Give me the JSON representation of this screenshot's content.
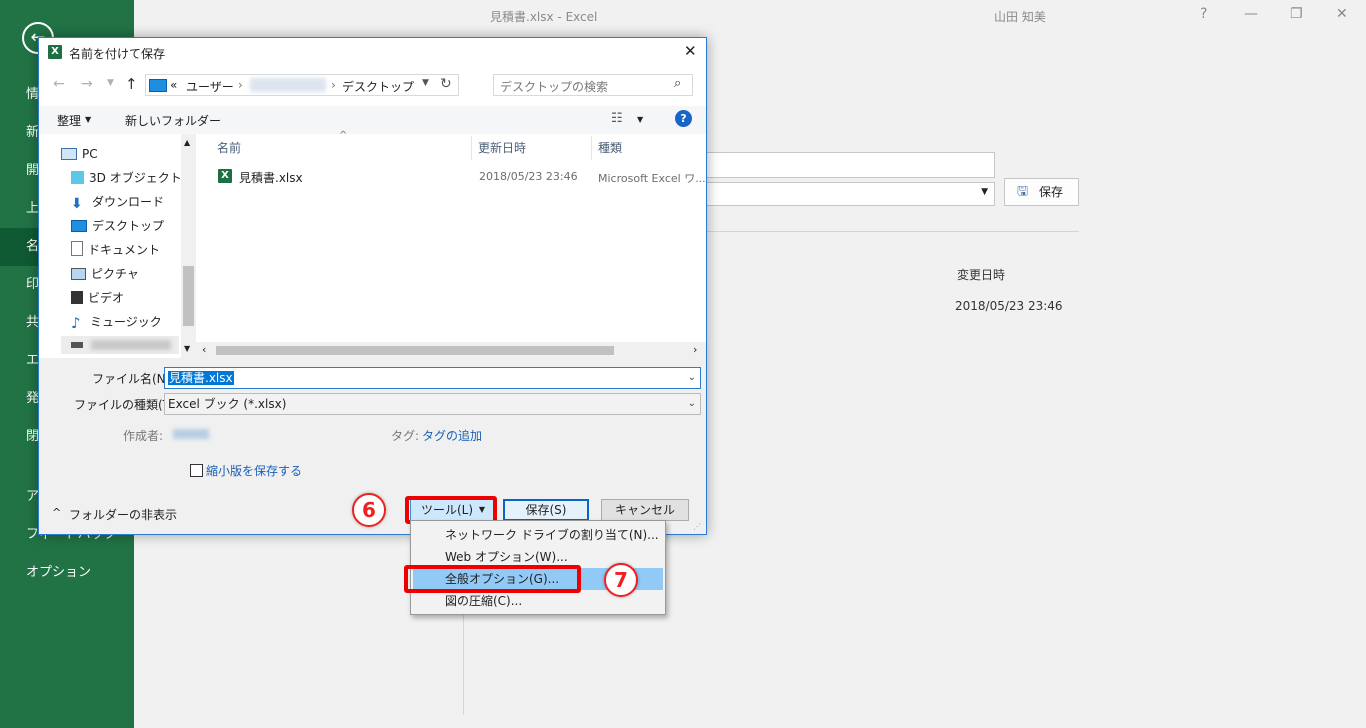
{
  "excel": {
    "window_title": "見積書.xlsx  -  Excel",
    "user": "山田 知美",
    "help": "?",
    "sidebar_items": [
      "情",
      "新",
      "開",
      "上",
      "名",
      "印",
      "共",
      "エ",
      "発",
      "閉",
      "アカ",
      "フィードバック",
      "オプション"
    ],
    "save_button": "保存",
    "modified_header": "変更日時",
    "modified_value": "2018/05/23 23:46"
  },
  "dialog": {
    "title": "名前を付けて保存",
    "breadcrumb": [
      "«",
      "ユーザー",
      "›",
      "›",
      "デスクトップ"
    ],
    "search_placeholder": "デスクトップの検索",
    "toolbar": {
      "organize": "整理",
      "new_folder": "新しいフォルダー"
    },
    "tree": [
      {
        "label": "PC",
        "icon": "pc-icon"
      },
      {
        "label": "3D オブジェクト",
        "icon": "cube-icon"
      },
      {
        "label": "ダウンロード",
        "icon": "download-icon"
      },
      {
        "label": "デスクトップ",
        "icon": "desktop-icon"
      },
      {
        "label": "ドキュメント",
        "icon": "document-icon"
      },
      {
        "label": "ピクチャ",
        "icon": "picture-icon"
      },
      {
        "label": "ビデオ",
        "icon": "video-icon"
      },
      {
        "label": "ミュージック",
        "icon": "music-icon"
      }
    ],
    "columns": [
      "名前",
      "更新日時",
      "種類"
    ],
    "files": [
      {
        "name": "見積書.xlsx",
        "modified": "2018/05/23 23:46",
        "type": "Microsoft Excel ワ..."
      }
    ],
    "filename_label": "ファイル名(N):",
    "filename_value": "見積書.xlsx",
    "filetype_label": "ファイルの種類(T):",
    "filetype_value": "Excel ブック (*.xlsx)",
    "author_label": "作成者:",
    "tags_label": "タグ:",
    "tags_value": "タグの追加",
    "thumbnail_label": "縮小版を保存する",
    "hide_folders": "フォルダーの非表示",
    "tools_button": "ツール(L)",
    "save_button": "保存(S)",
    "cancel_button": "キャンセル"
  },
  "tools_menu": [
    "ネットワーク ドライブの割り当て(N)...",
    "Web オプション(W)...",
    "全般オプション(G)...",
    "図の圧縮(C)..."
  ],
  "callouts": {
    "six": "6",
    "seven": "7"
  },
  "colors": {
    "excel_green": "#217346",
    "highlight": "#ee0000",
    "link": "#1a5fb4"
  }
}
